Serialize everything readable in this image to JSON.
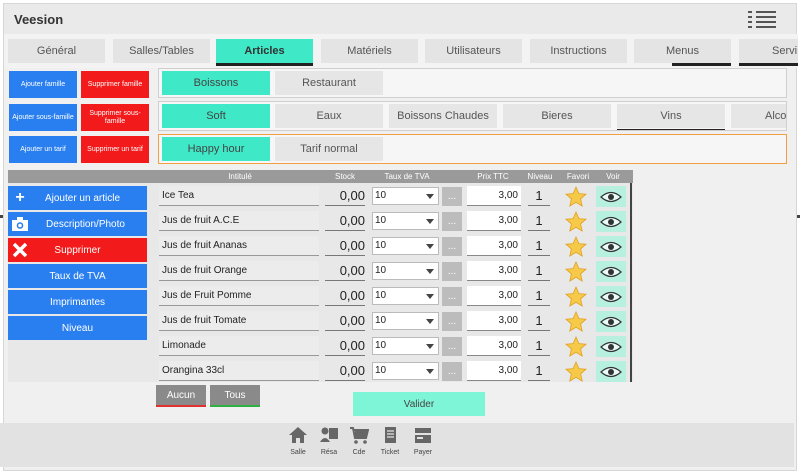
{
  "app": {
    "title": "Veesion"
  },
  "main_tabs": [
    {
      "label": "Général",
      "active": false
    },
    {
      "label": "Salles/Tables",
      "active": false
    },
    {
      "label": "Articles",
      "active": true
    },
    {
      "label": "Matériels",
      "active": false
    },
    {
      "label": "Utilisateurs",
      "active": false
    },
    {
      "label": "Instructions",
      "active": false
    },
    {
      "label": "Menus",
      "active": false
    },
    {
      "label": "Servi",
      "active": false
    }
  ],
  "side_buttons": {
    "add_family": "Ajouter famille",
    "delete_family": "Supprimer famille",
    "add_subfamily": "Ajouter sous-famille",
    "delete_subfamily": "Supprimer sous-famille",
    "add_tariff": "Ajouter un tarif",
    "delete_tariff": "Supprimer un tarif"
  },
  "families": [
    {
      "label": "Boissons",
      "active": true
    },
    {
      "label": "Restaurant",
      "active": false
    }
  ],
  "subfamilies": [
    {
      "label": "Soft",
      "active": true
    },
    {
      "label": "Eaux",
      "active": false
    },
    {
      "label": "Boissons Chaudes",
      "active": false
    },
    {
      "label": "Bieres",
      "active": false
    },
    {
      "label": "Vins",
      "active": false
    },
    {
      "label": "Alco",
      "active": false
    }
  ],
  "tariffs": [
    {
      "label": "Happy hour",
      "active": true
    },
    {
      "label": "Tarif normal",
      "active": false
    }
  ],
  "left_menu": {
    "add_article": "Ajouter un article",
    "description_photo": "Description/Photo",
    "delete": "Supprimer",
    "vat_rate": "Taux de TVA",
    "printers": "Imprimantes",
    "level": "Niveau"
  },
  "table": {
    "headers": {
      "name": "Intitulé",
      "stock": "Stock",
      "vat": "Taux de TVA",
      "price": "Prix TTC",
      "level": "Niveau",
      "favorite": "Favori",
      "view": "Voir"
    },
    "rows": [
      {
        "name": "Ice Tea",
        "stock": "0,00",
        "vat": "10",
        "dots": "...",
        "price": "3,00",
        "level": "1"
      },
      {
        "name": "Jus de fruit A.C.E",
        "stock": "0,00",
        "vat": "10",
        "dots": "...",
        "price": "3,00",
        "level": "1"
      },
      {
        "name": "Jus de fruit Ananas",
        "stock": "0,00",
        "vat": "10",
        "dots": "...",
        "price": "3,00",
        "level": "1"
      },
      {
        "name": "Jus de fruit Orange",
        "stock": "0,00",
        "vat": "10",
        "dots": "...",
        "price": "3,00",
        "level": "1"
      },
      {
        "name": "Jus de Fruit Pomme",
        "stock": "0,00",
        "vat": "10",
        "dots": "...",
        "price": "3,00",
        "level": "1"
      },
      {
        "name": "Jus de fruit Tomate",
        "stock": "0,00",
        "vat": "10",
        "dots": "...",
        "price": "3,00",
        "level": "1"
      },
      {
        "name": "Limonade",
        "stock": "0,00",
        "vat": "10",
        "dots": "...",
        "price": "3,00",
        "level": "1"
      },
      {
        "name": "Orangina 33cl",
        "stock": "0,00",
        "vat": "10",
        "dots": "...",
        "price": "3,00",
        "level": "1"
      }
    ]
  },
  "selection": {
    "none": "Aucun",
    "all": "Tous"
  },
  "validate": "Valider",
  "bottom_nav": [
    {
      "label": "Salle",
      "icon": "home-icon"
    },
    {
      "label": "Résa",
      "icon": "reservation-icon"
    },
    {
      "label": "Cde",
      "icon": "cart-icon"
    },
    {
      "label": "Ticket",
      "icon": "ticket-icon"
    },
    {
      "label": "Payer",
      "icon": "payment-icon"
    }
  ],
  "colors": {
    "accent": "#3fe8c6",
    "primary_blue": "#2a7ff0",
    "danger_red": "#f21a1a",
    "tariff_border": "#f0a040"
  }
}
